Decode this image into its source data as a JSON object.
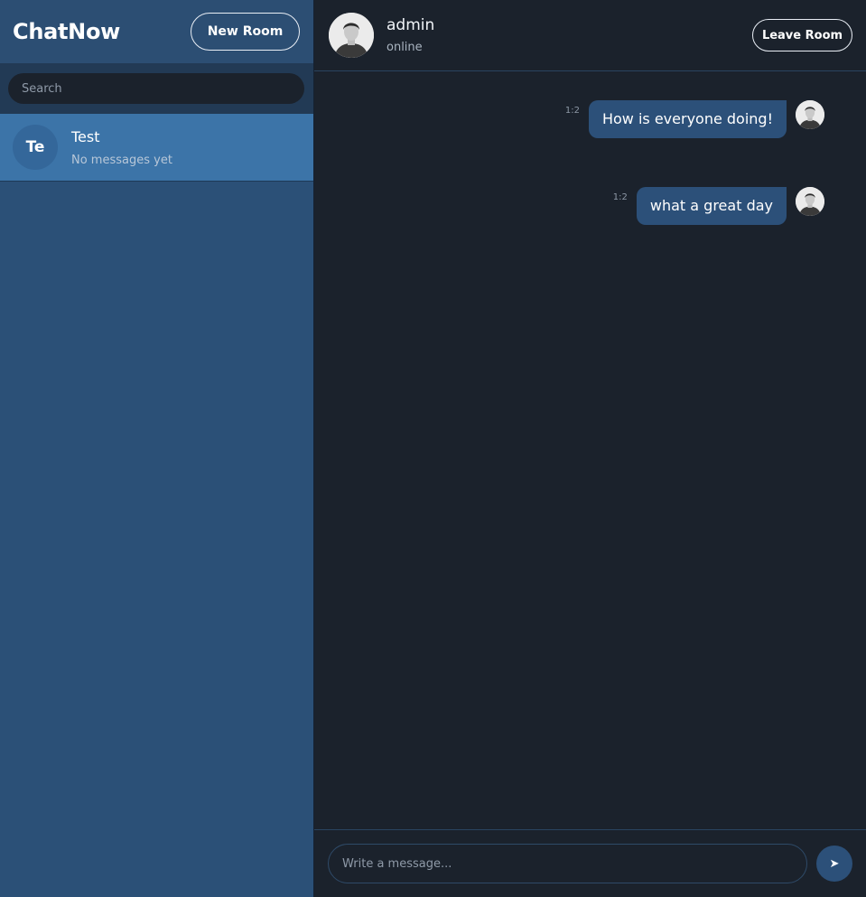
{
  "sidebar": {
    "app_title": "ChatNow",
    "new_room_label": "New Room",
    "search_placeholder": "Search",
    "rooms": [
      {
        "initials": "Te",
        "name": "Test",
        "preview": "No messages yet"
      }
    ]
  },
  "chat": {
    "user_name": "admin",
    "user_status": "online",
    "leave_label": "Leave Room",
    "messages": [
      {
        "time": "1:2",
        "text": "How is everyone doing!"
      },
      {
        "time": "1:2",
        "text": "what a great day"
      }
    ],
    "input_placeholder": "Write a message...",
    "send_icon": "➤"
  },
  "colors": {
    "sidebar_bg": "#2b5077",
    "active_room": "#3c74a8",
    "chat_bg": "#1b222c",
    "bubble": "#2c5079"
  },
  "icons": {
    "user_avatar": "user-avatar-icon",
    "send": "send-icon"
  }
}
